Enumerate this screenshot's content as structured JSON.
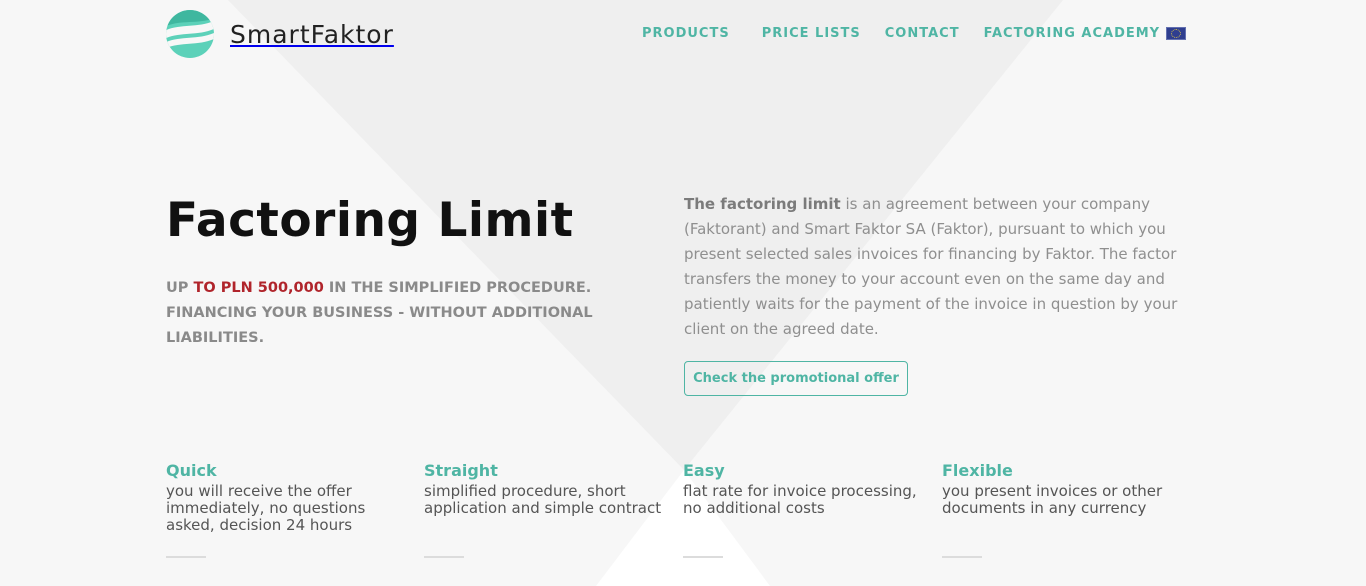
{
  "brand": {
    "name": "SmartFaktor",
    "accent": "#4fb5a4",
    "highlight": "#b0242b"
  },
  "nav": {
    "items": [
      "PRODUCTS",
      "PRICE LISTS",
      "CONTACT",
      "FACTORING ACADEMY"
    ],
    "language_icon": "eu-flag-icon"
  },
  "hero": {
    "title": "Factoring Limit",
    "sub_prefix": "UP ",
    "sub_highlight": "TO PLN 500,000",
    "sub_rest": " IN THE SIMPLIFIED PROCEDURE. FINANCING YOUR BUSINESS - WITHOUT ADDITIONAL LIABILITIES.",
    "desc_bold": "The factoring limit",
    "desc_rest": " is an agreement between your company (Faktorant) and Smart Faktor SA (Faktor), pursuant to which you present selected sales invoices for financing by Faktor. The factor transfers the money to your account even on the same day and patiently waits for the payment of the invoice in question by your client on the agreed date.",
    "cta": "Check the promotional offer"
  },
  "features": [
    {
      "title": "Quick",
      "text": "you will receive the offer immediately, no questions asked, decision 24 hours"
    },
    {
      "title": "Straight",
      "text": "simplified procedure, short application and simple contract"
    },
    {
      "title": "Easy",
      "text": "flat rate for invoice processing, no additional costs"
    },
    {
      "title": "Flexible",
      "text": "you present invoices or other documents in any currency"
    }
  ]
}
